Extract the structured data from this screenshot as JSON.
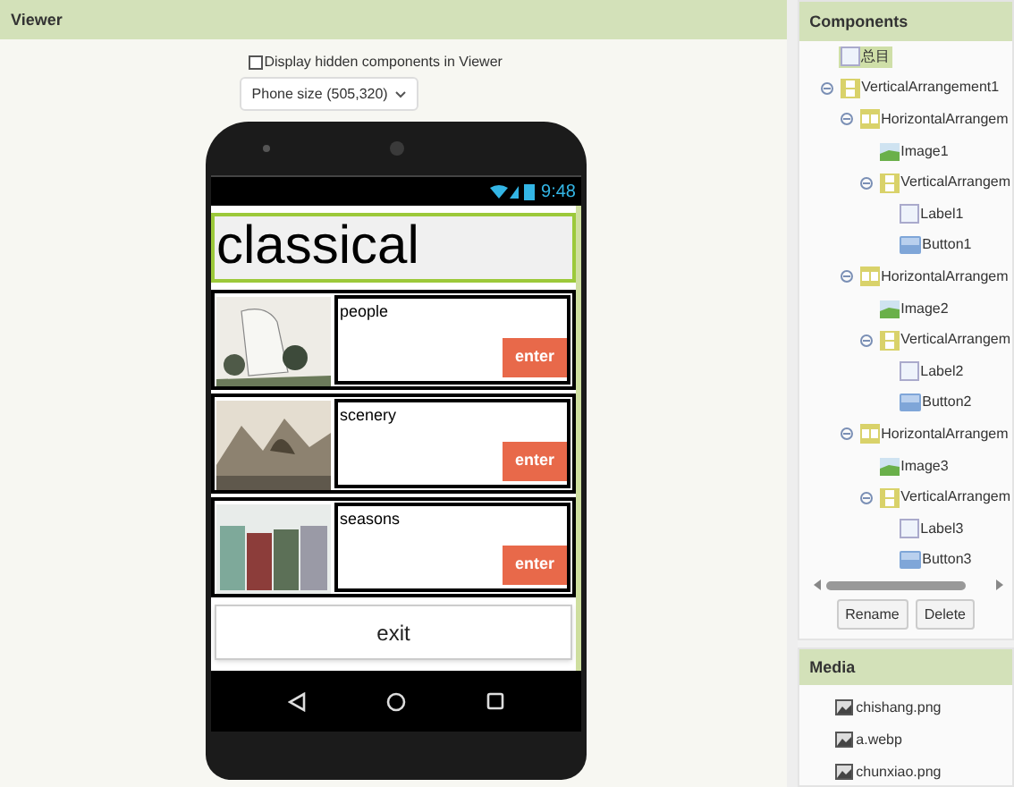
{
  "viewer": {
    "title": "Viewer",
    "hidden_checkbox": {
      "label": "Display hidden components in Viewer",
      "checked": false
    },
    "phone_size": "Phone size (505,320)"
  },
  "phone": {
    "status_time": "9:48",
    "title": "classical",
    "rows": [
      {
        "label": "people",
        "button": "enter"
      },
      {
        "label": "scenery",
        "button": "enter"
      },
      {
        "label": "seasons",
        "button": "enter"
      }
    ],
    "exit_button": "exit"
  },
  "components": {
    "title": "Components",
    "tree": [
      {
        "kind": "label",
        "label": "总目",
        "selected": true
      },
      {
        "kind": "vertical",
        "label": "VerticalArrangement1",
        "selected": false,
        "expanded": true,
        "children": [
          {
            "kind": "horizontal",
            "label": "HorizontalArrangem",
            "selected": false,
            "expanded": true,
            "children": [
              {
                "kind": "image",
                "label": "Image1",
                "selected": false
              },
              {
                "kind": "vertical",
                "label": "VerticalArrangem",
                "selected": false,
                "expanded": true,
                "children": [
                  {
                    "kind": "label",
                    "label": "Label1",
                    "selected": false
                  },
                  {
                    "kind": "button",
                    "label": "Button1",
                    "selected": false
                  }
                ]
              }
            ]
          },
          {
            "kind": "horizontal",
            "label": "HorizontalArrangem",
            "selected": false,
            "expanded": true,
            "children": [
              {
                "kind": "image",
                "label": "Image2",
                "selected": false
              },
              {
                "kind": "vertical",
                "label": "VerticalArrangem",
                "selected": false,
                "expanded": true,
                "children": [
                  {
                    "kind": "label",
                    "label": "Label2",
                    "selected": false
                  },
                  {
                    "kind": "button",
                    "label": "Button2",
                    "selected": false
                  }
                ]
              }
            ]
          },
          {
            "kind": "horizontal",
            "label": "HorizontalArrangem",
            "selected": false,
            "expanded": true,
            "children": [
              {
                "kind": "image",
                "label": "Image3",
                "selected": false
              },
              {
                "kind": "vertical",
                "label": "VerticalArrangem",
                "selected": false,
                "expanded": true,
                "children": [
                  {
                    "kind": "label",
                    "label": "Label3",
                    "selected": false
                  },
                  {
                    "kind": "button",
                    "label": "Button3",
                    "selected": false
                  }
                ]
              }
            ]
          }
        ]
      }
    ],
    "buttons": [
      "Rename",
      "Delete"
    ]
  },
  "media": {
    "title": "Media",
    "files": [
      "chishang.png",
      "a.webp",
      "chunxiao.png"
    ]
  }
}
